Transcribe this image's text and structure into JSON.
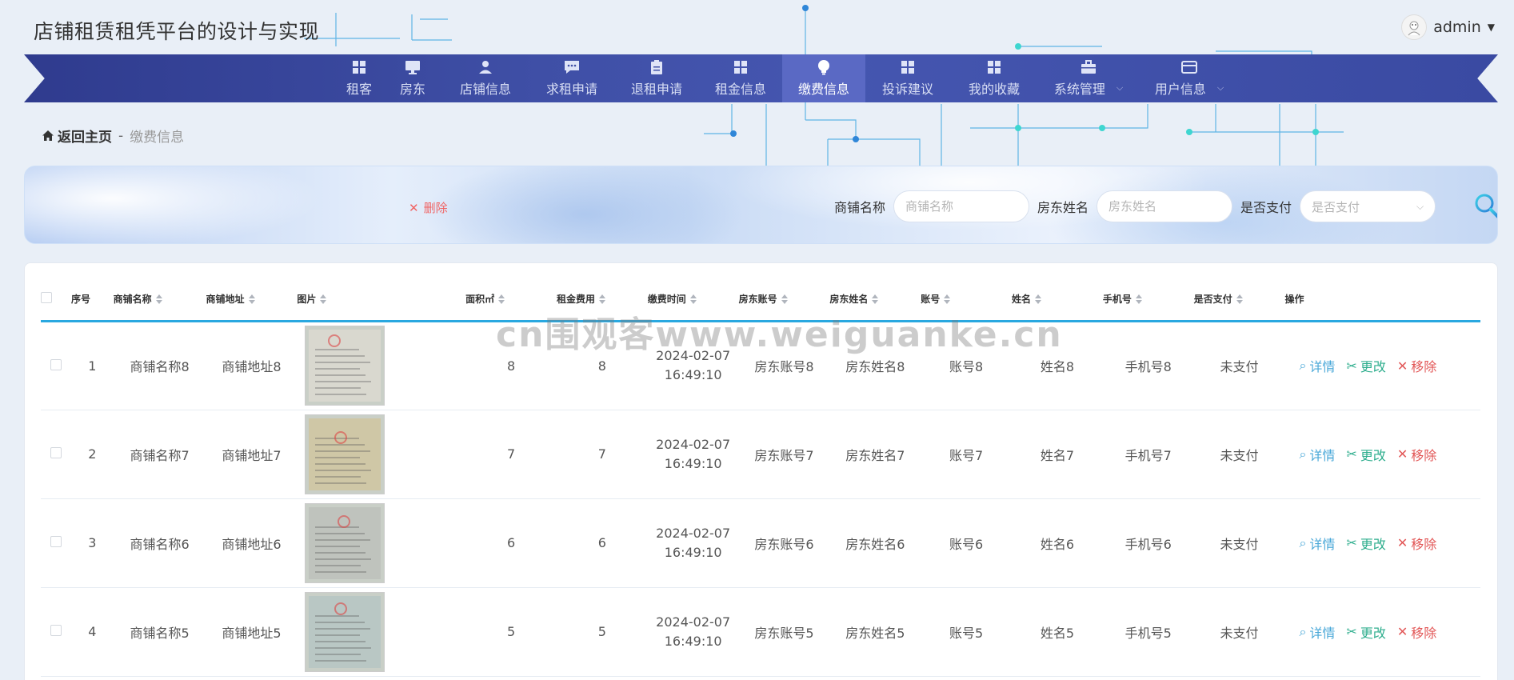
{
  "header": {
    "site_title": "店铺租赁租凭平台的设计与实现",
    "username": "admin"
  },
  "nav": {
    "items": [
      {
        "label": "租客",
        "icon": "grid-icon"
      },
      {
        "label": "房东",
        "icon": "monitor-icon"
      },
      {
        "label": "店铺信息",
        "icon": "user-icon"
      },
      {
        "label": "求租申请",
        "icon": "chat-icon"
      },
      {
        "label": "退租申请",
        "icon": "clipboard-icon"
      },
      {
        "label": "租金信息",
        "icon": "grid-icon"
      },
      {
        "label": "缴费信息",
        "icon": "bulb-icon",
        "active": true
      },
      {
        "label": "投诉建议",
        "icon": "grid-icon"
      },
      {
        "label": "我的收藏",
        "icon": "grid-icon"
      },
      {
        "label": "系统管理",
        "icon": "briefcase-icon",
        "dropdown": true
      },
      {
        "label": "用户信息",
        "icon": "card-icon",
        "dropdown": true
      }
    ]
  },
  "breadcrumb": {
    "home": "返回主页",
    "separator": "-",
    "current": "缴费信息"
  },
  "search": {
    "delete_label": "删除",
    "shop_name_label": "商铺名称",
    "shop_name_placeholder": "商铺名称",
    "landlord_name_label": "房东姓名",
    "landlord_name_placeholder": "房东姓名",
    "paid_label": "是否支付",
    "paid_placeholder": "是否支付"
  },
  "table": {
    "columns": [
      "序号",
      "商铺名称",
      "商铺地址",
      "图片",
      "面积㎡",
      "租金费用",
      "缴费时间",
      "房东账号",
      "房东姓名",
      "账号",
      "姓名",
      "手机号",
      "是否支付",
      "操作"
    ],
    "actions": {
      "detail": "详情",
      "edit": "更改",
      "remove": "移除"
    },
    "rows": [
      {
        "index": "1",
        "shop_name": "商铺名称8",
        "shop_address": "商铺地址8",
        "area": "8",
        "rent": "8",
        "date": "2024-02-07",
        "time": "16:49:10",
        "landlord_account": "房东账号8",
        "landlord_name": "房东姓名8",
        "account": "账号8",
        "name": "姓名8",
        "phone": "手机号8",
        "paid": "未支付"
      },
      {
        "index": "2",
        "shop_name": "商铺名称7",
        "shop_address": "商铺地址7",
        "area": "7",
        "rent": "7",
        "date": "2024-02-07",
        "time": "16:49:10",
        "landlord_account": "房东账号7",
        "landlord_name": "房东姓名7",
        "account": "账号7",
        "name": "姓名7",
        "phone": "手机号7",
        "paid": "未支付"
      },
      {
        "index": "3",
        "shop_name": "商铺名称6",
        "shop_address": "商铺地址6",
        "area": "6",
        "rent": "6",
        "date": "2024-02-07",
        "time": "16:49:10",
        "landlord_account": "房东账号6",
        "landlord_name": "房东姓名6",
        "account": "账号6",
        "name": "姓名6",
        "phone": "手机号6",
        "paid": "未支付"
      },
      {
        "index": "4",
        "shop_name": "商铺名称5",
        "shop_address": "商铺地址5",
        "area": "5",
        "rent": "5",
        "date": "2024-02-07",
        "time": "16:49:10",
        "landlord_account": "房东账号5",
        "landlord_name": "房东姓名5",
        "account": "账号5",
        "name": "姓名5",
        "phone": "手机号5",
        "paid": "未支付"
      }
    ]
  },
  "watermark": "cn围观客www.weiguanke.cn",
  "colors": {
    "nav_bg": "#3a4aa2",
    "accent": "#29a8e0",
    "delete": "#f06464",
    "edit": "#2fae8e",
    "detail": "#4aa8d8"
  }
}
